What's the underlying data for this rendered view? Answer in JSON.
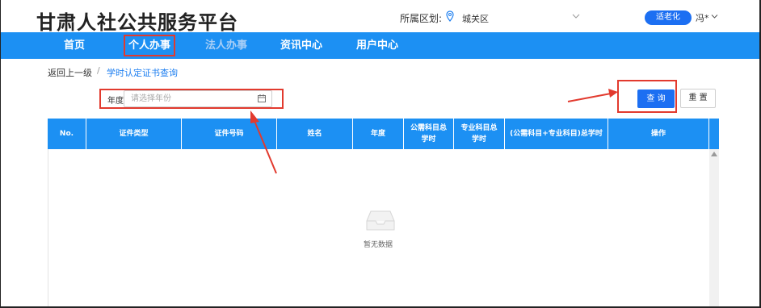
{
  "header": {
    "site_title": "甘肃人社公共服务平台",
    "region_label": "所属区划:",
    "region_value": "城关区",
    "elder_mode_label": "适老化",
    "user_name": "冯*"
  },
  "nav": {
    "items": [
      {
        "label": "首页"
      },
      {
        "label": "个人办事"
      },
      {
        "label": "法人办事"
      },
      {
        "label": "资讯中心"
      },
      {
        "label": "用户中心"
      }
    ]
  },
  "breadcrumb": {
    "back": "返回上一级",
    "separator": "/",
    "current": "学时认定证书查询"
  },
  "search": {
    "year_label": "年度",
    "year_placeholder": "请选择年份",
    "query_label": "查 询",
    "reset_label": "重 置"
  },
  "table": {
    "columns": [
      "No.",
      "证件类型",
      "证件号码",
      "姓名",
      "年度",
      "公需科目总学时",
      "专业科目总学时",
      "(公需科目+专业科目)总学时",
      "操作"
    ],
    "empty_text": "暂无数据"
  },
  "colors": {
    "nav_bg": "#1c90f3",
    "primary_button": "#1c6ff2",
    "annotation_red": "#e23a2e"
  },
  "icons": [
    "location-pin-icon",
    "chevron-down-icon",
    "calendar-icon",
    "empty-inbox-icon",
    "scroll-up-arrow-icon"
  ]
}
